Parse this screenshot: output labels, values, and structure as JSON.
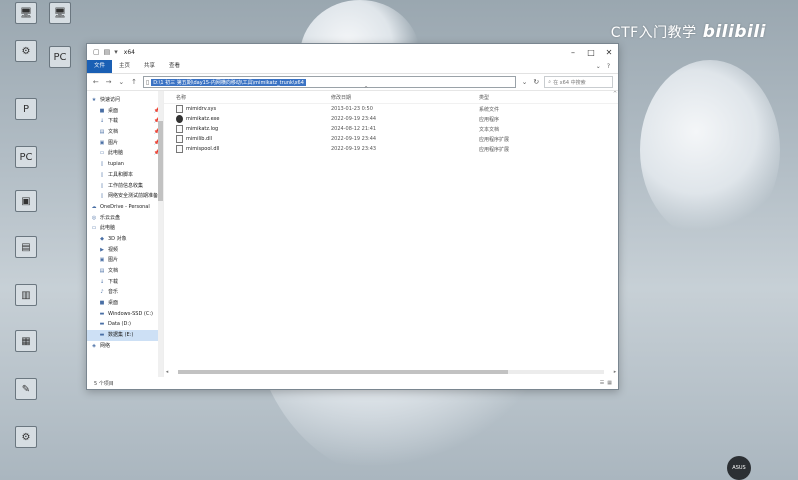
{
  "watermark": {
    "text": "CTF入门教学",
    "brand": "bilibili"
  },
  "desktop_icons": [
    {
      "label": "",
      "glyph": "🖥"
    },
    {
      "label": "",
      "glyph": "🖥"
    },
    {
      "label": "",
      "glyph": "⚙"
    },
    {
      "label": "",
      "glyph": "PC"
    },
    {
      "label": "",
      "glyph": "P"
    },
    {
      "label": "",
      "glyph": "PC"
    },
    {
      "label": "",
      "glyph": "▣"
    },
    {
      "label": "",
      "glyph": "▤"
    },
    {
      "label": "",
      "glyph": "▥"
    },
    {
      "label": "",
      "glyph": "▦"
    },
    {
      "label": "",
      "glyph": "✎"
    },
    {
      "label": "",
      "glyph": "⚙"
    }
  ],
  "window": {
    "title": "x64",
    "ribbon_tabs": [
      "文件",
      "主页",
      "共享",
      "查看"
    ],
    "address_path": "D:\\1 初三 第五期\\day15-内网横向移动\\工具\\mimikatz_trunk\\x64",
    "search_placeholder": "在 x64 中搜索",
    "columns": {
      "name": "名称",
      "date": "修改日期",
      "type": "类型"
    },
    "files": [
      {
        "name": "mimidrv.sys",
        "date": "2013-01-23 0:50",
        "type": "系统文件",
        "icon": "sys"
      },
      {
        "name": "mimikatz.exe",
        "date": "2022-09-19 23:44",
        "type": "应用程序",
        "icon": "exe"
      },
      {
        "name": "mimikatz.log",
        "date": "2024-08-12 21:41",
        "type": "文本文档",
        "icon": "txt"
      },
      {
        "name": "mimilib.dll",
        "date": "2022-09-19 23:44",
        "type": "应用程序扩展",
        "icon": "dll"
      },
      {
        "name": "mimispool.dll",
        "date": "2022-09-19 23:43",
        "type": "应用程序扩展",
        "icon": "dll"
      }
    ],
    "sidebar": [
      {
        "label": "快速访问",
        "icon": "★",
        "pin": "",
        "level": 0
      },
      {
        "label": "桌面",
        "icon": "■",
        "pin": "📌",
        "level": 1
      },
      {
        "label": "下载",
        "icon": "↓",
        "pin": "📌",
        "level": 1
      },
      {
        "label": "文档",
        "icon": "▤",
        "pin": "📌",
        "level": 1
      },
      {
        "label": "图片",
        "icon": "▣",
        "pin": "📌",
        "level": 1
      },
      {
        "label": "此电脑",
        "icon": "▭",
        "pin": "📌",
        "level": 1
      },
      {
        "label": "tupian",
        "icon": "▯",
        "pin": "",
        "level": 1
      },
      {
        "label": "工具和脚本",
        "icon": "▯",
        "pin": "",
        "level": 1
      },
      {
        "label": "工作前信息收集",
        "icon": "▯",
        "pin": "",
        "level": 1
      },
      {
        "label": "网络安全测试前期准备",
        "icon": "▯",
        "pin": "",
        "level": 1
      },
      {
        "label": "OneDrive - Personal",
        "icon": "☁",
        "pin": "",
        "level": 0
      },
      {
        "label": "乐云云盘",
        "icon": "◎",
        "pin": "",
        "level": 0
      },
      {
        "label": "此电脑",
        "icon": "▭",
        "pin": "",
        "level": 0
      },
      {
        "label": "3D 对象",
        "icon": "◆",
        "pin": "",
        "level": 1
      },
      {
        "label": "视频",
        "icon": "▶",
        "pin": "",
        "level": 1
      },
      {
        "label": "图片",
        "icon": "▣",
        "pin": "",
        "level": 1
      },
      {
        "label": "文档",
        "icon": "▤",
        "pin": "",
        "level": 1
      },
      {
        "label": "下载",
        "icon": "↓",
        "pin": "",
        "level": 1
      },
      {
        "label": "音乐",
        "icon": "♪",
        "pin": "",
        "level": 1
      },
      {
        "label": "桌面",
        "icon": "■",
        "pin": "",
        "level": 1
      },
      {
        "label": "Windows-SSD (C:)",
        "icon": "▬",
        "pin": "",
        "level": 1
      },
      {
        "label": "Data (D:)",
        "icon": "▬",
        "pin": "",
        "level": 1
      },
      {
        "label": "数据集 (E:)",
        "icon": "▬",
        "pin": "",
        "level": 1,
        "selected": true
      },
      {
        "label": "网络",
        "icon": "◈",
        "pin": "",
        "level": 0
      }
    ],
    "status": "5 个项目"
  },
  "corner_logo": "ASUS",
  "colors": {
    "accent": "#1a5fb4",
    "selection": "#3b73c4"
  }
}
